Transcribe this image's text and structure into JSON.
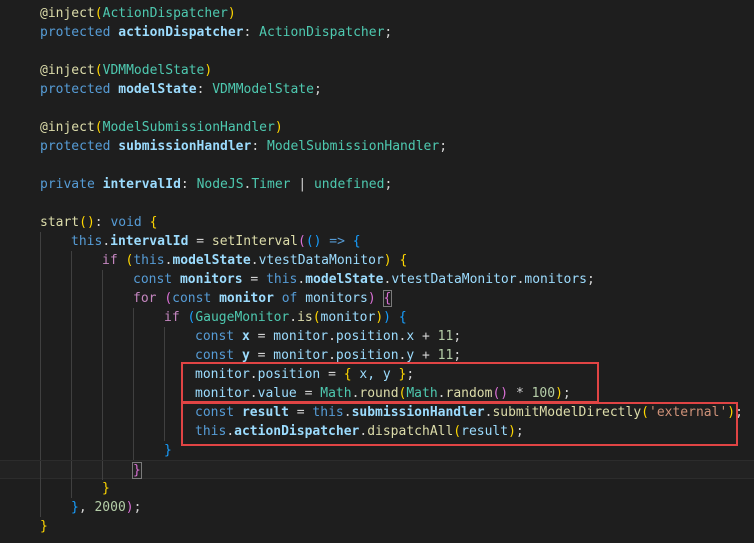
{
  "colors": {
    "background": "#1e1e1e",
    "highlight_border": "#e04444"
  },
  "lines": [
    {
      "indent": 0,
      "tokens": [
        {
          "t": "@inject",
          "c": "dec"
        },
        {
          "t": "(",
          "c": "br1"
        },
        {
          "t": "ActionDispatcher",
          "c": "type"
        },
        {
          "t": ")",
          "c": "br1"
        }
      ]
    },
    {
      "indent": 0,
      "tokens": [
        {
          "t": "protected ",
          "c": "kw"
        },
        {
          "t": "actionDispatcher",
          "c": "prop",
          "b": 1
        },
        {
          "t": ": ",
          "c": "pun"
        },
        {
          "t": "ActionDispatcher",
          "c": "type"
        },
        {
          "t": ";",
          "c": "pun"
        }
      ]
    },
    {
      "indent": 0,
      "tokens": []
    },
    {
      "indent": 0,
      "tokens": [
        {
          "t": "@inject",
          "c": "dec"
        },
        {
          "t": "(",
          "c": "br1"
        },
        {
          "t": "VDMModelState",
          "c": "type"
        },
        {
          "t": ")",
          "c": "br1"
        }
      ]
    },
    {
      "indent": 0,
      "tokens": [
        {
          "t": "protected ",
          "c": "kw"
        },
        {
          "t": "modelState",
          "c": "prop",
          "b": 1
        },
        {
          "t": ": ",
          "c": "pun"
        },
        {
          "t": "VDMModelState",
          "c": "type"
        },
        {
          "t": ";",
          "c": "pun"
        }
      ]
    },
    {
      "indent": 0,
      "tokens": []
    },
    {
      "indent": 0,
      "tokens": [
        {
          "t": "@inject",
          "c": "dec"
        },
        {
          "t": "(",
          "c": "br1"
        },
        {
          "t": "ModelSubmissionHandler",
          "c": "type"
        },
        {
          "t": ")",
          "c": "br1"
        }
      ]
    },
    {
      "indent": 0,
      "tokens": [
        {
          "t": "protected ",
          "c": "kw"
        },
        {
          "t": "submissionHandler",
          "c": "prop",
          "b": 1
        },
        {
          "t": ": ",
          "c": "pun"
        },
        {
          "t": "ModelSubmissionHandler",
          "c": "type"
        },
        {
          "t": ";",
          "c": "pun"
        }
      ]
    },
    {
      "indent": 0,
      "tokens": []
    },
    {
      "indent": 0,
      "tokens": [
        {
          "t": "private ",
          "c": "kw"
        },
        {
          "t": "intervalId",
          "c": "prop",
          "b": 1
        },
        {
          "t": ": ",
          "c": "pun"
        },
        {
          "t": "NodeJS",
          "c": "type"
        },
        {
          "t": ".",
          "c": "pun"
        },
        {
          "t": "Timer",
          "c": "type"
        },
        {
          "t": " | ",
          "c": "pun"
        },
        {
          "t": "undefined",
          "c": "type"
        },
        {
          "t": ";",
          "c": "pun"
        }
      ]
    },
    {
      "indent": 0,
      "tokens": []
    },
    {
      "indent": 0,
      "tokens": [
        {
          "t": "start",
          "c": "fn"
        },
        {
          "t": "()",
          "c": "br1"
        },
        {
          "t": ": ",
          "c": "pun"
        },
        {
          "t": "void ",
          "c": "kw"
        },
        {
          "t": "{",
          "c": "br1"
        }
      ]
    },
    {
      "indent": 1,
      "tokens": [
        {
          "t": "this",
          "c": "kw"
        },
        {
          "t": ".",
          "c": "pun"
        },
        {
          "t": "intervalId",
          "c": "prop",
          "b": 1
        },
        {
          "t": " = ",
          "c": "pun"
        },
        {
          "t": "setInterval",
          "c": "fn"
        },
        {
          "t": "(",
          "c": "br2"
        },
        {
          "t": "()",
          "c": "br3"
        },
        {
          "t": " => ",
          "c": "kw"
        },
        {
          "t": "{",
          "c": "br3"
        }
      ]
    },
    {
      "indent": 2,
      "tokens": [
        {
          "t": "if ",
          "c": "ctl"
        },
        {
          "t": "(",
          "c": "br1"
        },
        {
          "t": "this",
          "c": "kw"
        },
        {
          "t": ".",
          "c": "pun"
        },
        {
          "t": "modelState",
          "c": "prop",
          "b": 1
        },
        {
          "t": ".",
          "c": "pun"
        },
        {
          "t": "vtestDataMonitor",
          "c": "prop"
        },
        {
          "t": ")",
          "c": "br1"
        },
        {
          "t": " ",
          "c": "pun"
        },
        {
          "t": "{",
          "c": "br1"
        }
      ]
    },
    {
      "indent": 3,
      "tokens": [
        {
          "t": "const ",
          "c": "kw"
        },
        {
          "t": "monitors",
          "c": "var",
          "b": 1
        },
        {
          "t": " = ",
          "c": "pun"
        },
        {
          "t": "this",
          "c": "kw"
        },
        {
          "t": ".",
          "c": "pun"
        },
        {
          "t": "modelState",
          "c": "prop",
          "b": 1
        },
        {
          "t": ".",
          "c": "pun"
        },
        {
          "t": "vtestDataMonitor",
          "c": "prop"
        },
        {
          "t": ".",
          "c": "pun"
        },
        {
          "t": "monitors",
          "c": "prop"
        },
        {
          "t": ";",
          "c": "pun"
        }
      ]
    },
    {
      "indent": 3,
      "tokens": [
        {
          "t": "for ",
          "c": "ctl"
        },
        {
          "t": "(",
          "c": "br2"
        },
        {
          "t": "const ",
          "c": "kw"
        },
        {
          "t": "monitor",
          "c": "var",
          "b": 1
        },
        {
          "t": " of ",
          "c": "kw"
        },
        {
          "t": "monitors",
          "c": "var"
        },
        {
          "t": ")",
          "c": "br2"
        },
        {
          "t": " ",
          "c": "pun"
        },
        {
          "t": "{",
          "c": "br2",
          "box": 1
        }
      ]
    },
    {
      "indent": 4,
      "tokens": [
        {
          "t": "if ",
          "c": "ctl"
        },
        {
          "t": "(",
          "c": "br3"
        },
        {
          "t": "GaugeMonitor",
          "c": "type"
        },
        {
          "t": ".",
          "c": "pun"
        },
        {
          "t": "is",
          "c": "fn"
        },
        {
          "t": "(",
          "c": "br1"
        },
        {
          "t": "monitor",
          "c": "var"
        },
        {
          "t": ")",
          "c": "br1"
        },
        {
          "t": ")",
          "c": "br3"
        },
        {
          "t": " ",
          "c": "pun"
        },
        {
          "t": "{",
          "c": "br3"
        }
      ]
    },
    {
      "indent": 5,
      "tokens": [
        {
          "t": "const ",
          "c": "kw"
        },
        {
          "t": "x",
          "c": "var",
          "b": 1
        },
        {
          "t": " = ",
          "c": "pun"
        },
        {
          "t": "monitor",
          "c": "var"
        },
        {
          "t": ".",
          "c": "pun"
        },
        {
          "t": "position",
          "c": "prop"
        },
        {
          "t": ".",
          "c": "pun"
        },
        {
          "t": "x",
          "c": "prop"
        },
        {
          "t": " + ",
          "c": "pun"
        },
        {
          "t": "11",
          "c": "num"
        },
        {
          "t": ";",
          "c": "pun"
        }
      ]
    },
    {
      "indent": 5,
      "tokens": [
        {
          "t": "const ",
          "c": "kw"
        },
        {
          "t": "y",
          "c": "var",
          "b": 1
        },
        {
          "t": " = ",
          "c": "pun"
        },
        {
          "t": "monitor",
          "c": "var"
        },
        {
          "t": ".",
          "c": "pun"
        },
        {
          "t": "position",
          "c": "prop"
        },
        {
          "t": ".",
          "c": "pun"
        },
        {
          "t": "y",
          "c": "prop"
        },
        {
          "t": " + ",
          "c": "pun"
        },
        {
          "t": "11",
          "c": "num"
        },
        {
          "t": ";",
          "c": "pun"
        }
      ]
    },
    {
      "indent": 5,
      "tokens": [
        {
          "t": "monitor",
          "c": "var"
        },
        {
          "t": ".",
          "c": "pun"
        },
        {
          "t": "position",
          "c": "prop"
        },
        {
          "t": " = ",
          "c": "pun"
        },
        {
          "t": "{",
          "c": "br1"
        },
        {
          "t": " x, y ",
          "c": "var"
        },
        {
          "t": "}",
          "c": "br1"
        },
        {
          "t": ";",
          "c": "pun"
        }
      ]
    },
    {
      "indent": 5,
      "tokens": [
        {
          "t": "monitor",
          "c": "var"
        },
        {
          "t": ".",
          "c": "pun"
        },
        {
          "t": "value",
          "c": "prop"
        },
        {
          "t": " = ",
          "c": "pun"
        },
        {
          "t": "Math",
          "c": "type"
        },
        {
          "t": ".",
          "c": "pun"
        },
        {
          "t": "round",
          "c": "fn"
        },
        {
          "t": "(",
          "c": "br1"
        },
        {
          "t": "Math",
          "c": "type"
        },
        {
          "t": ".",
          "c": "pun"
        },
        {
          "t": "random",
          "c": "fn"
        },
        {
          "t": "()",
          "c": "br2"
        },
        {
          "t": " * ",
          "c": "pun"
        },
        {
          "t": "100",
          "c": "num"
        },
        {
          "t": ")",
          "c": "br1"
        },
        {
          "t": ";",
          "c": "pun"
        }
      ]
    },
    {
      "indent": 5,
      "tokens": [
        {
          "t": "const ",
          "c": "kw"
        },
        {
          "t": "result",
          "c": "var",
          "b": 1
        },
        {
          "t": " = ",
          "c": "pun"
        },
        {
          "t": "this",
          "c": "kw"
        },
        {
          "t": ".",
          "c": "pun"
        },
        {
          "t": "submissionHandler",
          "c": "prop",
          "b": 1
        },
        {
          "t": ".",
          "c": "pun"
        },
        {
          "t": "submitModelDirectly",
          "c": "fn"
        },
        {
          "t": "(",
          "c": "br1"
        },
        {
          "t": "'external'",
          "c": "str"
        },
        {
          "t": ")",
          "c": "br1"
        },
        {
          "t": ";",
          "c": "pun"
        }
      ]
    },
    {
      "indent": 5,
      "tokens": [
        {
          "t": "this",
          "c": "kw"
        },
        {
          "t": ".",
          "c": "pun"
        },
        {
          "t": "actionDispatcher",
          "c": "prop",
          "b": 1
        },
        {
          "t": ".",
          "c": "pun"
        },
        {
          "t": "dispatchAll",
          "c": "fn"
        },
        {
          "t": "(",
          "c": "br1"
        },
        {
          "t": "result",
          "c": "var"
        },
        {
          "t": ")",
          "c": "br1"
        },
        {
          "t": ";",
          "c": "pun"
        }
      ]
    },
    {
      "indent": 4,
      "tokens": [
        {
          "t": "}",
          "c": "br3"
        }
      ]
    },
    {
      "indent": 3,
      "tokens": [
        {
          "t": "}",
          "c": "br2",
          "box": 1
        }
      ],
      "cursor": 1
    },
    {
      "indent": 2,
      "tokens": [
        {
          "t": "}",
          "c": "br1"
        }
      ]
    },
    {
      "indent": 1,
      "tokens": [
        {
          "t": "}",
          "c": "br3"
        },
        {
          "t": ", ",
          "c": "pun"
        },
        {
          "t": "2000",
          "c": "num"
        },
        {
          "t": ")",
          "c": "br2"
        },
        {
          "t": ";",
          "c": "pun"
        }
      ]
    },
    {
      "indent": 0,
      "tokens": [
        {
          "t": "}",
          "c": "br1"
        }
      ]
    }
  ]
}
